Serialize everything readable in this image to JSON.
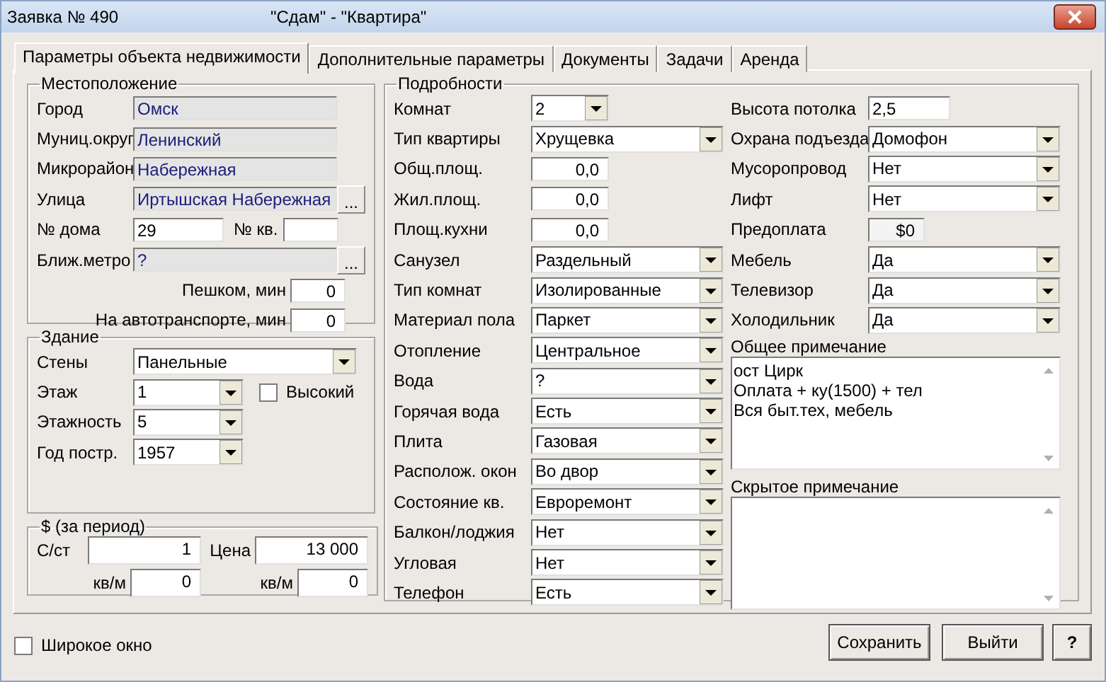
{
  "window": {
    "title": "Заявка № 490",
    "subtitle": "\"Сдам\" - \"Квартира\""
  },
  "tabs": [
    {
      "label": "Параметры объекта недвижимости",
      "selected": true
    },
    {
      "label": "Дополнительные параметры",
      "selected": false
    },
    {
      "label": "Документы",
      "selected": false
    },
    {
      "label": "Задачи",
      "selected": false
    },
    {
      "label": "Аренда",
      "selected": false
    }
  ],
  "location": {
    "title": "Местоположение",
    "rows": [
      {
        "kind": "readonly",
        "label": "Город",
        "value": "Омск"
      },
      {
        "kind": "readonly",
        "label": "Муниц.округ",
        "value": "Ленинский"
      },
      {
        "kind": "readonly",
        "label": "Микрорайон",
        "value": "Набережная"
      },
      {
        "kind": "browse",
        "label": "Улица",
        "value": "Иртышская Набережная",
        "button": "..."
      },
      {
        "kind": "pair",
        "label": "№ дома",
        "value": "29",
        "label_2": "№ кв."
      },
      {
        "kind": "browse",
        "label": "Ближ.метро",
        "value": "?",
        "button": "..."
      },
      {
        "kind": "minutes",
        "label": "Пешком, мин",
        "value": "0"
      },
      {
        "kind": "minutes",
        "label": "На автотранспорте, мин",
        "value": "0"
      }
    ]
  },
  "building": {
    "title": "Здание",
    "rows": [
      {
        "kind": "wide",
        "label": "Стены",
        "value": "Панельные"
      },
      {
        "kind": "short",
        "label": "Этаж",
        "value": "1",
        "checkbox": {
          "label": "Высокий",
          "checked": false
        }
      },
      {
        "kind": "short",
        "label": "Этажность",
        "value": "5"
      },
      {
        "kind": "short",
        "label": "Год постр.",
        "value": "1957"
      }
    ]
  },
  "price": {
    "title": "$ (за период)",
    "fields": [
      {
        "label": "С/ст",
        "value": "1"
      },
      {
        "label": "Цена",
        "value": "13 000"
      },
      {
        "label": "кв/м",
        "value": "0"
      },
      {
        "label": "кв/м",
        "value": "0"
      }
    ]
  },
  "details": {
    "title": "Подробности",
    "left": [
      {
        "kind": "combo_short",
        "label": "Комнат",
        "value": "2"
      },
      {
        "kind": "combo",
        "label": "Тип квартиры",
        "value": "Хрущевка"
      },
      {
        "kind": "number",
        "label": "Общ.площ.",
        "value": "0,0"
      },
      {
        "kind": "number",
        "label": "Жил.площ.",
        "value": "0,0"
      },
      {
        "kind": "number",
        "label": "Площ.кухни",
        "value": "0,0"
      },
      {
        "kind": "combo",
        "label": "Санузел",
        "value": "Раздельный"
      },
      {
        "kind": "combo",
        "label": "Тип комнат",
        "value": "Изолированные"
      },
      {
        "kind": "combo",
        "label": "Материал пола",
        "value": "Паркет"
      },
      {
        "kind": "combo",
        "label": "Отопление",
        "value": "Центральное"
      },
      {
        "kind": "combo",
        "label": "Вода",
        "value": "?"
      },
      {
        "kind": "combo",
        "label": "Горячая вода",
        "value": "Есть"
      },
      {
        "kind": "combo",
        "label": "Плита",
        "value": "Газовая"
      },
      {
        "kind": "combo",
        "label": "Располож. окон",
        "value": "Во двор"
      },
      {
        "kind": "combo",
        "label": "Состояние кв.",
        "value": "Евроремонт"
      },
      {
        "kind": "combo",
        "label": "Балкон/лоджия",
        "value": "Нет"
      },
      {
        "kind": "combo",
        "label": "Угловая",
        "value": "Нет"
      },
      {
        "kind": "combo",
        "label": "Телефон",
        "value": "Есть"
      }
    ],
    "right": [
      {
        "kind": "text",
        "label": "Высота потолка",
        "value": "2,5"
      },
      {
        "kind": "combo",
        "label": "Охрана подъезда",
        "value": "Домофон"
      },
      {
        "kind": "combo",
        "label": "Мусоропровод",
        "value": "Нет"
      },
      {
        "kind": "combo",
        "label": "Лифт",
        "value": "Нет"
      },
      {
        "kind": "money",
        "label": "Предоплата",
        "value": "$0"
      },
      {
        "kind": "combo",
        "label": "Мебель",
        "value": "Да"
      },
      {
        "kind": "combo",
        "label": "Телевизор",
        "value": "Да"
      },
      {
        "kind": "combo",
        "label": "Холодильник",
        "value": "Да"
      }
    ],
    "notes": [
      {
        "label": "Общее примечание",
        "lines": [
          "ост Цирк",
          "Оплата + ку(1500) + тел",
          "Вся быт.тех, мебель"
        ]
      },
      {
        "label": "Скрытое примечание"
      }
    ]
  },
  "wide_window": {
    "label": "Широкое окно",
    "checked": false
  },
  "buttons": [
    {
      "kind": "text",
      "label": "Сохранить"
    },
    {
      "kind": "text",
      "label": "Выйти"
    },
    {
      "kind": "help",
      "label": "?"
    }
  ]
}
